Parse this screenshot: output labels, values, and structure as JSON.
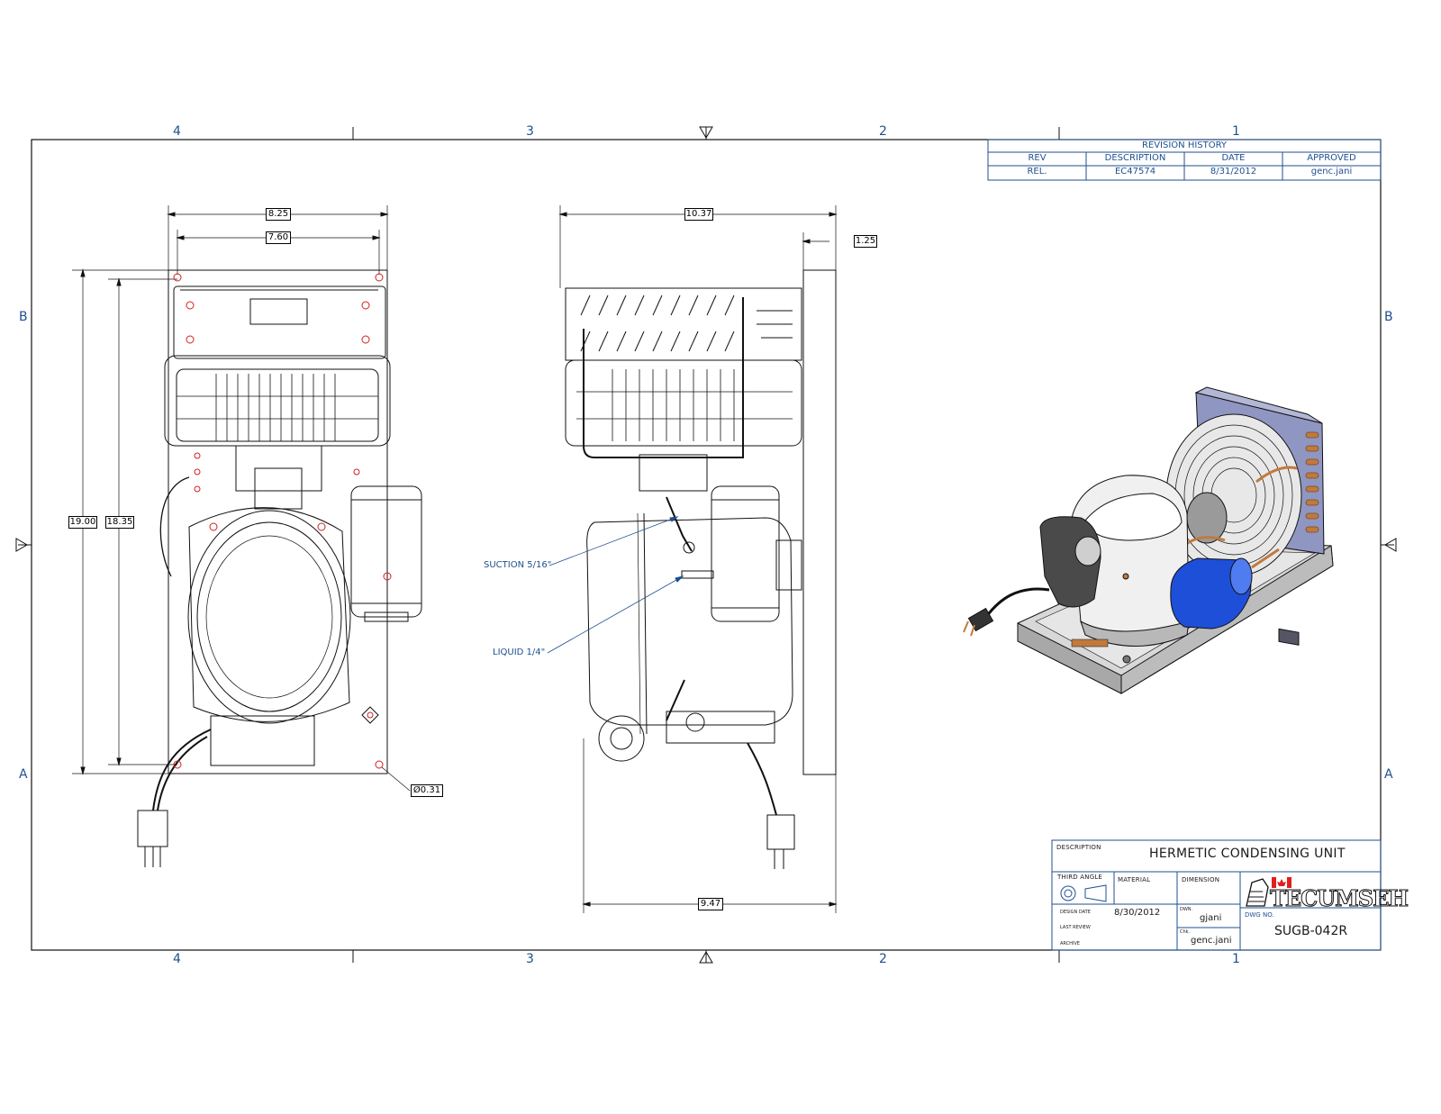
{
  "zones": {
    "columns": [
      "4",
      "3",
      "2",
      "1"
    ],
    "rows": [
      "B",
      "A"
    ]
  },
  "revision_history": {
    "title": "REVISION HISTORY",
    "headers": [
      "REV",
      "DESCRIPTION",
      "DATE",
      "APPROVED"
    ],
    "rows": [
      [
        "REL.",
        "EC47574",
        "8/31/2012",
        "genc.jani"
      ]
    ]
  },
  "dimensions": {
    "front_width_outer": "8.25",
    "front_width_inner": "7.60",
    "front_height_outer": "19.00",
    "front_height_inner": "18.35",
    "hole_diameter": "Ø0.31",
    "side_depth": "10.37",
    "side_offset": "1.25",
    "side_base": "9.47"
  },
  "callouts": {
    "suction": "SUCTION 5/16\"",
    "liquid": "LIQUID 1/4\""
  },
  "title_block": {
    "description_label": "DESCRIPTION",
    "description": "HERMETIC CONDENSING UNIT",
    "third_angle_label": "THIRD ANGLE",
    "material_label": "MATERIAL",
    "dimension_label": "DIMENSION",
    "design_date_label": "DESIGN DATE",
    "design_date": "8/30/2012",
    "last_review_label": "LAST REVIEW",
    "archive_label": "ARCHIVE",
    "dwn_label": "DWN.",
    "dwn_value": "gjani",
    "chk_label": "Chk.",
    "chk_value": "genc.jani",
    "dwg_no_label": "DWG NO.",
    "dwg_no": "SUGB-042R",
    "logo_text": "TECUMSEH"
  },
  "colors": {
    "frame_blue": "#1f4f8f",
    "line": "#111111",
    "mount_hole_red": "#d21f1f",
    "filter_drier_blue": "#1e4fd8",
    "copper": "#c07a3e"
  }
}
